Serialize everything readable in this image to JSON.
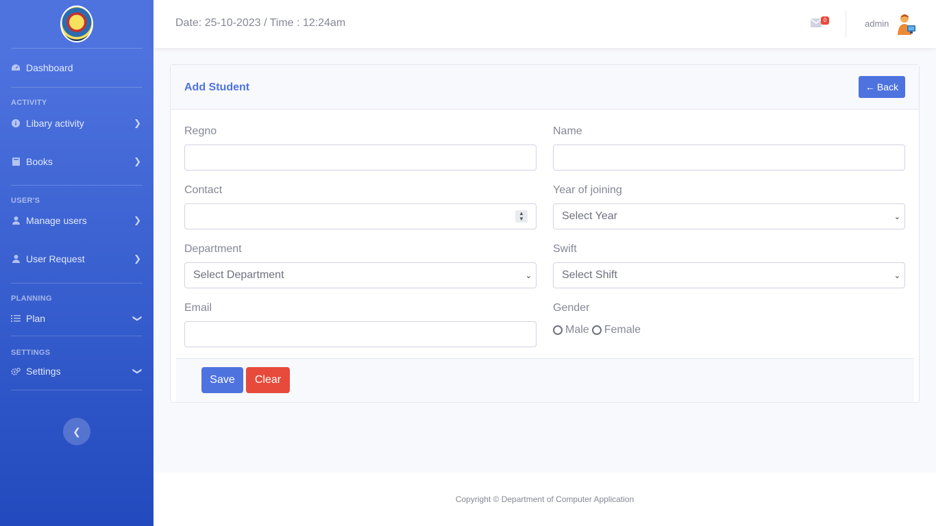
{
  "sidebar": {
    "dashboard": "Dashboard",
    "sections": [
      {
        "heading": "ACTIVITY"
      },
      {
        "heading": "USER'S"
      },
      {
        "heading": "PLANNING"
      },
      {
        "heading": "SETTINGS"
      }
    ],
    "items": [
      {
        "label": "Libary activity",
        "icon": "info-circle-icon"
      },
      {
        "label": "Books",
        "icon": "book-icon"
      },
      {
        "label": "Manage users",
        "icon": "user-icon"
      },
      {
        "label": "User Request",
        "icon": "user-icon"
      },
      {
        "label": "Plan",
        "icon": "list-icon"
      },
      {
        "label": "Settings",
        "icon": "cogs-icon"
      }
    ]
  },
  "topbar": {
    "datetime": "Date: 25-10-2023 / Time : 12:24am",
    "message_count": "0",
    "username": "admin"
  },
  "card": {
    "title": "Add Student",
    "back_label": "Back",
    "fields": {
      "regno": {
        "label": "Regno",
        "value": ""
      },
      "name": {
        "label": "Name",
        "value": ""
      },
      "contact": {
        "label": "Contact",
        "value": ""
      },
      "year": {
        "label": "Year of joining",
        "selected": "Select Year"
      },
      "department": {
        "label": "Department",
        "selected": "Select Department"
      },
      "shift": {
        "label": "Swift",
        "selected": "Select Shift"
      },
      "email": {
        "label": "Email",
        "value": ""
      },
      "gender": {
        "label": "Gender",
        "options": [
          "Male",
          "Female"
        ]
      }
    },
    "save_label": "Save",
    "clear_label": "Clear"
  },
  "footer": {
    "copyright": "Copyright © Department of Computer Application"
  },
  "colors": {
    "primary": "#4e73df",
    "danger": "#e74a3b",
    "sidebar_end": "#224abe"
  }
}
